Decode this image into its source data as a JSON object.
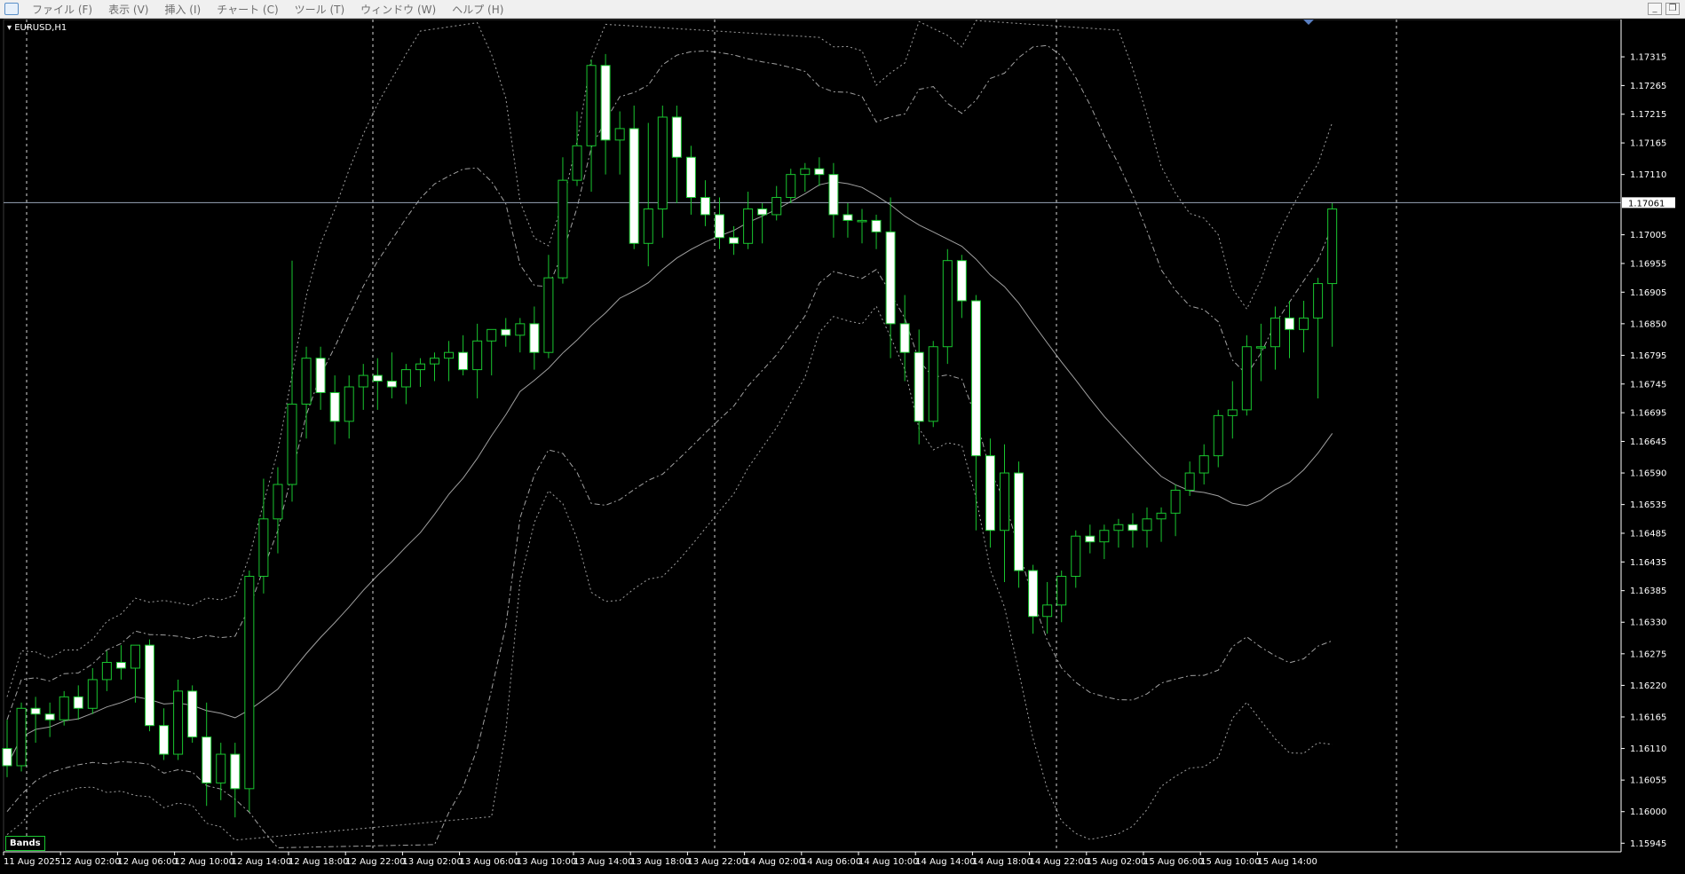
{
  "menu": {
    "items": [
      "ファイル (F)",
      "表示 (V)",
      "挿入 (I)",
      "チャート (C)",
      "ツール (T)",
      "ウィンドウ (W)",
      "ヘルプ (H)"
    ],
    "window_buttons": [
      "_",
      "❐"
    ]
  },
  "chart": {
    "symbol_label": "EURUSD,H1",
    "indicator_label": "Bands",
    "current_price_label": "1.17061",
    "colors": {
      "background": "#000000",
      "bull_body": "#000000",
      "bull_outline": "#19c62f",
      "bear_body": "#ffffff",
      "wick": "#19c62f",
      "bands": "#c8c8c8",
      "price_line": "#9aa6b8",
      "grid": "#ffffff",
      "axis_text": "#ffffff"
    }
  },
  "chart_data": {
    "type": "candlestick",
    "symbol": "EURUSD",
    "timeframe": "H1",
    "current_price": 1.17061,
    "y_ticks": [
      "1.17315",
      "1.17265",
      "1.17215",
      "1.17165",
      "1.17110",
      "1.17005",
      "1.16955",
      "1.16905",
      "1.16850",
      "1.16795",
      "1.16745",
      "1.16695",
      "1.16645",
      "1.16590",
      "1.16535",
      "1.16485",
      "1.16435",
      "1.16385",
      "1.16330",
      "1.16275",
      "1.16220",
      "1.16165",
      "1.16110",
      "1.16055",
      "1.16000",
      "1.15945"
    ],
    "x_ticks": [
      "11 Aug 2025",
      "12 Aug 02:00",
      "12 Aug 06:00",
      "12 Aug 10:00",
      "12 Aug 14:00",
      "12 Aug 18:00",
      "12 Aug 22:00",
      "13 Aug 02:00",
      "13 Aug 06:00",
      "13 Aug 10:00",
      "13 Aug 14:00",
      "13 Aug 18:00",
      "13 Aug 22:00",
      "14 Aug 02:00",
      "14 Aug 06:00",
      "14 Aug 10:00",
      "14 Aug 14:00",
      "14 Aug 18:00",
      "14 Aug 22:00",
      "15 Aug 02:00",
      "15 Aug 06:00",
      "15 Aug 10:00",
      "15 Aug 14:00"
    ],
    "candles": [
      {
        "o": 1.1611,
        "h": 1.1616,
        "l": 1.1606,
        "c": 1.1608
      },
      {
        "o": 1.1608,
        "h": 1.1619,
        "l": 1.1607,
        "c": 1.1618
      },
      {
        "o": 1.1618,
        "h": 1.162,
        "l": 1.1612,
        "c": 1.1617
      },
      {
        "o": 1.1617,
        "h": 1.1619,
        "l": 1.1613,
        "c": 1.1616
      },
      {
        "o": 1.1616,
        "h": 1.1621,
        "l": 1.1615,
        "c": 1.162
      },
      {
        "o": 1.162,
        "h": 1.1622,
        "l": 1.1616,
        "c": 1.1618
      },
      {
        "o": 1.1618,
        "h": 1.1625,
        "l": 1.1617,
        "c": 1.1623
      },
      {
        "o": 1.1623,
        "h": 1.1628,
        "l": 1.1621,
        "c": 1.1626
      },
      {
        "o": 1.1626,
        "h": 1.1629,
        "l": 1.1623,
        "c": 1.1625
      },
      {
        "o": 1.1625,
        "h": 1.1629,
        "l": 1.1619,
        "c": 1.1629
      },
      {
        "o": 1.1629,
        "h": 1.163,
        "l": 1.1614,
        "c": 1.1615
      },
      {
        "o": 1.1615,
        "h": 1.1618,
        "l": 1.1609,
        "c": 1.161
      },
      {
        "o": 1.161,
        "h": 1.1623,
        "l": 1.1609,
        "c": 1.1621
      },
      {
        "o": 1.1621,
        "h": 1.1622,
        "l": 1.1612,
        "c": 1.1613
      },
      {
        "o": 1.1613,
        "h": 1.1619,
        "l": 1.1601,
        "c": 1.1605
      },
      {
        "o": 1.1605,
        "h": 1.1612,
        "l": 1.1602,
        "c": 1.161
      },
      {
        "o": 1.161,
        "h": 1.1612,
        "l": 1.1599,
        "c": 1.1604
      },
      {
        "o": 1.1604,
        "h": 1.1642,
        "l": 1.16,
        "c": 1.1641
      },
      {
        "o": 1.1641,
        "h": 1.1658,
        "l": 1.1638,
        "c": 1.1651
      },
      {
        "o": 1.1651,
        "h": 1.166,
        "l": 1.1645,
        "c": 1.1657
      },
      {
        "o": 1.1657,
        "h": 1.1696,
        "l": 1.1654,
        "c": 1.1671
      },
      {
        "o": 1.1671,
        "h": 1.1681,
        "l": 1.1665,
        "c": 1.1679
      },
      {
        "o": 1.1679,
        "h": 1.1681,
        "l": 1.167,
        "c": 1.1673
      },
      {
        "o": 1.1673,
        "h": 1.1676,
        "l": 1.1664,
        "c": 1.1668
      },
      {
        "o": 1.1668,
        "h": 1.1676,
        "l": 1.1665,
        "c": 1.1674
      },
      {
        "o": 1.1674,
        "h": 1.1678,
        "l": 1.167,
        "c": 1.1676
      },
      {
        "o": 1.1676,
        "h": 1.1679,
        "l": 1.167,
        "c": 1.1675
      },
      {
        "o": 1.1675,
        "h": 1.168,
        "l": 1.1672,
        "c": 1.1674
      },
      {
        "o": 1.1674,
        "h": 1.1678,
        "l": 1.1671,
        "c": 1.1677
      },
      {
        "o": 1.1677,
        "h": 1.1679,
        "l": 1.1674,
        "c": 1.1678
      },
      {
        "o": 1.1678,
        "h": 1.168,
        "l": 1.1675,
        "c": 1.1679
      },
      {
        "o": 1.1679,
        "h": 1.1682,
        "l": 1.1675,
        "c": 1.168
      },
      {
        "o": 1.168,
        "h": 1.1683,
        "l": 1.1676,
        "c": 1.1677
      },
      {
        "o": 1.1677,
        "h": 1.1685,
        "l": 1.1672,
        "c": 1.1682
      },
      {
        "o": 1.1682,
        "h": 1.1684,
        "l": 1.1676,
        "c": 1.1684
      },
      {
        "o": 1.1684,
        "h": 1.1686,
        "l": 1.1681,
        "c": 1.1683
      },
      {
        "o": 1.1683,
        "h": 1.1686,
        "l": 1.168,
        "c": 1.1685
      },
      {
        "o": 1.1685,
        "h": 1.1688,
        "l": 1.1677,
        "c": 1.168
      },
      {
        "o": 1.168,
        "h": 1.1697,
        "l": 1.1679,
        "c": 1.1693
      },
      {
        "o": 1.1693,
        "h": 1.1714,
        "l": 1.1692,
        "c": 1.171
      },
      {
        "o": 1.171,
        "h": 1.1722,
        "l": 1.1709,
        "c": 1.1716
      },
      {
        "o": 1.1716,
        "h": 1.1731,
        "l": 1.1708,
        "c": 1.173
      },
      {
        "o": 1.173,
        "h": 1.1732,
        "l": 1.1711,
        "c": 1.1717
      },
      {
        "o": 1.1717,
        "h": 1.1722,
        "l": 1.1711,
        "c": 1.1719
      },
      {
        "o": 1.1719,
        "h": 1.1723,
        "l": 1.1698,
        "c": 1.1699
      },
      {
        "o": 1.1699,
        "h": 1.172,
        "l": 1.1695,
        "c": 1.1705
      },
      {
        "o": 1.1705,
        "h": 1.1723,
        "l": 1.17,
        "c": 1.1721
      },
      {
        "o": 1.1721,
        "h": 1.1723,
        "l": 1.1706,
        "c": 1.1714
      },
      {
        "o": 1.1714,
        "h": 1.1716,
        "l": 1.1704,
        "c": 1.1707
      },
      {
        "o": 1.1707,
        "h": 1.171,
        "l": 1.1702,
        "c": 1.1704
      },
      {
        "o": 1.1704,
        "h": 1.1707,
        "l": 1.1698,
        "c": 1.17
      },
      {
        "o": 1.17,
        "h": 1.1702,
        "l": 1.1697,
        "c": 1.1699
      },
      {
        "o": 1.1699,
        "h": 1.1708,
        "l": 1.1698,
        "c": 1.1705
      },
      {
        "o": 1.1705,
        "h": 1.1706,
        "l": 1.1699,
        "c": 1.1704
      },
      {
        "o": 1.1704,
        "h": 1.1709,
        "l": 1.1703,
        "c": 1.1707
      },
      {
        "o": 1.1707,
        "h": 1.1712,
        "l": 1.1706,
        "c": 1.1711
      },
      {
        "o": 1.1711,
        "h": 1.1713,
        "l": 1.1708,
        "c": 1.1712
      },
      {
        "o": 1.1712,
        "h": 1.1714,
        "l": 1.1709,
        "c": 1.1711
      },
      {
        "o": 1.1711,
        "h": 1.1713,
        "l": 1.17,
        "c": 1.1704
      },
      {
        "o": 1.1704,
        "h": 1.1706,
        "l": 1.17,
        "c": 1.1703
      },
      {
        "o": 1.1703,
        "h": 1.1705,
        "l": 1.1699,
        "c": 1.1703
      },
      {
        "o": 1.1703,
        "h": 1.1704,
        "l": 1.1698,
        "c": 1.1701
      },
      {
        "o": 1.1701,
        "h": 1.1707,
        "l": 1.1679,
        "c": 1.1685
      },
      {
        "o": 1.1685,
        "h": 1.169,
        "l": 1.1675,
        "c": 1.168
      },
      {
        "o": 1.168,
        "h": 1.1684,
        "l": 1.1664,
        "c": 1.1668
      },
      {
        "o": 1.1668,
        "h": 1.1682,
        "l": 1.1667,
        "c": 1.1681
      },
      {
        "o": 1.1681,
        "h": 1.1698,
        "l": 1.1678,
        "c": 1.1696
      },
      {
        "o": 1.1696,
        "h": 1.1697,
        "l": 1.1686,
        "c": 1.1689
      },
      {
        "o": 1.1689,
        "h": 1.169,
        "l": 1.1649,
        "c": 1.1662
      },
      {
        "o": 1.1662,
        "h": 1.1665,
        "l": 1.1646,
        "c": 1.1649
      },
      {
        "o": 1.1649,
        "h": 1.1664,
        "l": 1.164,
        "c": 1.1659
      },
      {
        "o": 1.1659,
        "h": 1.1661,
        "l": 1.1639,
        "c": 1.1642
      },
      {
        "o": 1.1642,
        "h": 1.1643,
        "l": 1.1631,
        "c": 1.1634
      },
      {
        "o": 1.1634,
        "h": 1.164,
        "l": 1.1631,
        "c": 1.1636
      },
      {
        "o": 1.1636,
        "h": 1.1642,
        "l": 1.1633,
        "c": 1.1641
      },
      {
        "o": 1.1641,
        "h": 1.1649,
        "l": 1.1639,
        "c": 1.1648
      },
      {
        "o": 1.1648,
        "h": 1.165,
        "l": 1.1645,
        "c": 1.1647
      },
      {
        "o": 1.1647,
        "h": 1.165,
        "l": 1.1644,
        "c": 1.1649
      },
      {
        "o": 1.1649,
        "h": 1.1651,
        "l": 1.1646,
        "c": 1.165
      },
      {
        "o": 1.165,
        "h": 1.1652,
        "l": 1.1646,
        "c": 1.1649
      },
      {
        "o": 1.1649,
        "h": 1.1653,
        "l": 1.1646,
        "c": 1.1651
      },
      {
        "o": 1.1651,
        "h": 1.1653,
        "l": 1.1647,
        "c": 1.1652
      },
      {
        "o": 1.1652,
        "h": 1.1657,
        "l": 1.1648,
        "c": 1.1656
      },
      {
        "o": 1.1656,
        "h": 1.1661,
        "l": 1.1655,
        "c": 1.1659
      },
      {
        "o": 1.1659,
        "h": 1.1664,
        "l": 1.1657,
        "c": 1.1662
      },
      {
        "o": 1.1662,
        "h": 1.167,
        "l": 1.166,
        "c": 1.1669
      },
      {
        "o": 1.1669,
        "h": 1.1675,
        "l": 1.1665,
        "c": 1.167
      },
      {
        "o": 1.167,
        "h": 1.1683,
        "l": 1.1669,
        "c": 1.1681
      },
      {
        "o": 1.1681,
        "h": 1.1685,
        "l": 1.1675,
        "c": 1.1681
      },
      {
        "o": 1.1681,
        "h": 1.1688,
        "l": 1.1677,
        "c": 1.1686
      },
      {
        "o": 1.1686,
        "h": 1.1689,
        "l": 1.1679,
        "c": 1.1684
      },
      {
        "o": 1.1684,
        "h": 1.1689,
        "l": 1.168,
        "c": 1.1686
      },
      {
        "o": 1.1686,
        "h": 1.1693,
        "l": 1.1672,
        "c": 1.1692
      },
      {
        "o": 1.1692,
        "h": 1.1706,
        "l": 1.1681,
        "c": 1.1705
      }
    ],
    "ylim": [
      1.1593,
      1.1738
    ],
    "legend": "none",
    "grid": "vertical dotted"
  }
}
